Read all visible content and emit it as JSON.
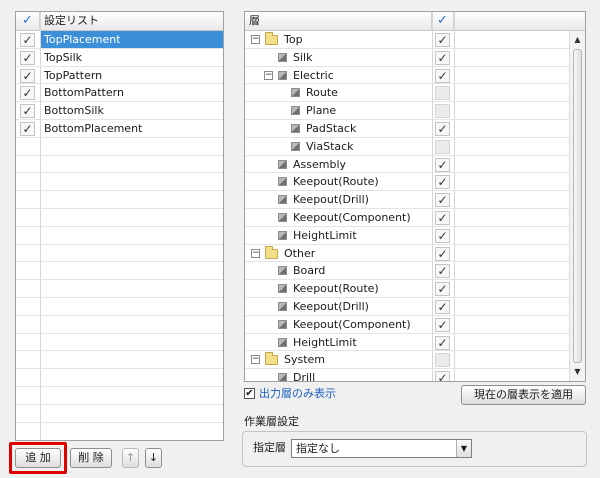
{
  "left_list": {
    "header_check": "✓",
    "header_title": "設定リスト",
    "items": [
      {
        "label": "TopPlacement",
        "checked": true,
        "selected": true
      },
      {
        "label": "TopSilk",
        "checked": true,
        "selected": false
      },
      {
        "label": "TopPattern",
        "checked": true,
        "selected": false
      },
      {
        "label": "BottomPattern",
        "checked": true,
        "selected": false
      },
      {
        "label": "BottomSilk",
        "checked": true,
        "selected": false
      },
      {
        "label": "BottomPlacement",
        "checked": true,
        "selected": false
      }
    ],
    "empty_rows": 16
  },
  "buttons": {
    "add": "追 加",
    "delete": "削 除",
    "up": "↑",
    "down": "↓",
    "apply_current": "現在の層表示を適用"
  },
  "layer_tree": {
    "header_title": "層",
    "header_check": "✓",
    "nodes": [
      {
        "label": "Top",
        "level": 0,
        "kind": "folder",
        "expander": "⊟",
        "checked": true
      },
      {
        "label": "Silk",
        "level": 1,
        "kind": "layer",
        "checked": true
      },
      {
        "label": "Electric",
        "level": 1,
        "kind": "layer",
        "expander": "⊟",
        "checked": true
      },
      {
        "label": "Route",
        "level": 2,
        "kind": "layer",
        "checked": false
      },
      {
        "label": "Plane",
        "level": 2,
        "kind": "layer",
        "checked": false
      },
      {
        "label": "PadStack",
        "level": 2,
        "kind": "layer",
        "checked": true
      },
      {
        "label": "ViaStack",
        "level": 2,
        "kind": "layer",
        "checked": false
      },
      {
        "label": "Assembly",
        "level": 1,
        "kind": "layer",
        "checked": true
      },
      {
        "label": "Keepout(Route)",
        "level": 1,
        "kind": "layer",
        "checked": true
      },
      {
        "label": "Keepout(Drill)",
        "level": 1,
        "kind": "layer",
        "checked": true
      },
      {
        "label": "Keepout(Component)",
        "level": 1,
        "kind": "layer",
        "checked": true
      },
      {
        "label": "HeightLimit",
        "level": 1,
        "kind": "layer",
        "checked": true
      },
      {
        "label": "Other",
        "level": 0,
        "kind": "folder",
        "expander": "⊟",
        "checked": true
      },
      {
        "label": "Board",
        "level": 1,
        "kind": "layer",
        "checked": true
      },
      {
        "label": "Keepout(Route)",
        "level": 1,
        "kind": "layer",
        "checked": true
      },
      {
        "label": "Keepout(Drill)",
        "level": 1,
        "kind": "layer",
        "checked": true
      },
      {
        "label": "Keepout(Component)",
        "level": 1,
        "kind": "layer",
        "checked": true
      },
      {
        "label": "HeightLimit",
        "level": 1,
        "kind": "layer",
        "checked": true
      },
      {
        "label": "System",
        "level": 0,
        "kind": "folder",
        "expander": "⊟",
        "checked": false
      },
      {
        "label": "Drill",
        "level": 1,
        "kind": "layer",
        "checked": true
      }
    ],
    "scroll_up": "▲",
    "scroll_down": "▼"
  },
  "output_only": {
    "label": "出力層のみ表示",
    "checked": true
  },
  "work_layer": {
    "group_title": "作業層設定",
    "field_label": "指定層",
    "selected_value": "指定なし",
    "arrow": "▼"
  },
  "colors": {
    "selection": "#3b8fd8",
    "link_blue": "#1f5fbf",
    "highlight_red": "#e00000"
  }
}
